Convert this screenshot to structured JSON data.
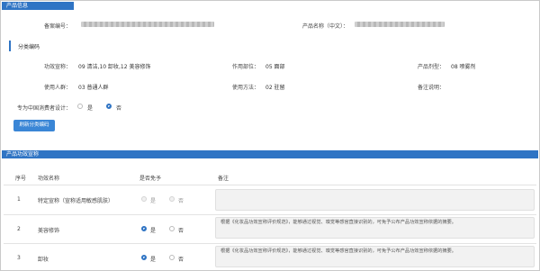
{
  "info_section": {
    "header": "产品信息",
    "filing_no_label": "备案编号：",
    "product_name_label": "产品名称（中文）：",
    "classification_title": "分类编码",
    "efficacy_label": "功效宣称：",
    "efficacy_value": "09 清洁,10 卸妆,12 美容修饰",
    "location_label": "作用部位：",
    "location_value": "05 面部",
    "form_label": "产品剂型：",
    "form_value": "08 喷雾剂",
    "user_label": "使用人群：",
    "user_value": "03 普通人群",
    "method_label": "使用方法：",
    "method_value": "02 驻留",
    "note_label": "备注说明：",
    "designed_label": "专为中国消费者设计：",
    "yes": "是",
    "no": "否",
    "refresh_button": "刷新分类编码"
  },
  "efficacy_section": {
    "header": "产品功效宣称",
    "columns": [
      "序号",
      "功效名称",
      "是否免予",
      "备注"
    ],
    "rows": [
      {
        "no": "1",
        "name": "特定宣称（宣称适用敏感肌肤）",
        "exempt": "否",
        "disabled": true,
        "remark": ""
      },
      {
        "no": "2",
        "name": "美容修饰",
        "exempt": "是",
        "disabled": false,
        "remark": "根据《化妆品功效宣称评价规范》，能够通过视觉、嗅觉等感官直接识别的，可免予公布产品功效宣称依据的摘要。"
      },
      {
        "no": "3",
        "name": "卸妆",
        "exempt": "是",
        "disabled": false,
        "remark": "根据《化妆品功效宣称评价规范》，能够通过视觉、嗅觉等感官直接识别的，可免予公布产品功效宣称依据的摘要。"
      }
    ]
  },
  "colors": {
    "accent": "#2f74c4",
    "button": "#3a86d6"
  }
}
